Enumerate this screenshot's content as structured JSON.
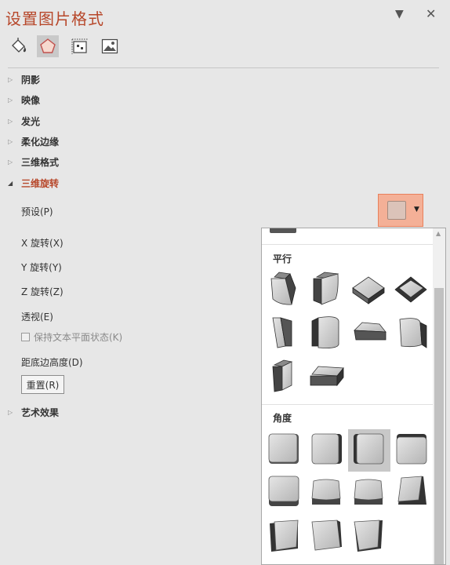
{
  "pane": {
    "title": "设置图片格式",
    "dropdown_icon": "chevron-down-icon",
    "close_icon": "close-icon"
  },
  "tabs": [
    {
      "name": "fill-line",
      "icon": "paint-bucket-icon",
      "active": false
    },
    {
      "name": "effects",
      "icon": "pentagon-icon",
      "active": true
    },
    {
      "name": "size-properties",
      "icon": "size-properties-icon",
      "active": false
    },
    {
      "name": "picture",
      "icon": "picture-icon",
      "active": false
    }
  ],
  "sections": [
    {
      "label": "阴影",
      "expanded": false
    },
    {
      "label": "映像",
      "expanded": false
    },
    {
      "label": "发光",
      "expanded": false
    },
    {
      "label": "柔化边缘",
      "expanded": false
    },
    {
      "label": "三维格式",
      "expanded": false
    },
    {
      "label": "三维旋转",
      "expanded": true
    },
    {
      "label": "艺术效果",
      "expanded": false
    }
  ],
  "rotation": {
    "preset_label": "预设(P)",
    "x_label": "X 旋转(X)",
    "y_label": "Y 旋转(Y)",
    "z_label": "Z 旋转(Z)",
    "perspective_label": "透视(E)",
    "keep_text_flat_label": "保持文本平面状态(K)",
    "keep_text_flat_checked": false,
    "keep_text_flat_enabled": false,
    "distance_label": "距底边高度(D)",
    "reset_label": "重置(R)"
  },
  "gallery": {
    "groups": [
      {
        "label": "平行",
        "count": 10
      },
      {
        "label": "角度",
        "count": 11,
        "selected_index": 2
      }
    ]
  },
  "colors": {
    "accent": "#b7472a",
    "panel_bg": "#e7e7e7",
    "preset_highlight": "#f4b097",
    "selected_cell": "#c8c8c8"
  }
}
